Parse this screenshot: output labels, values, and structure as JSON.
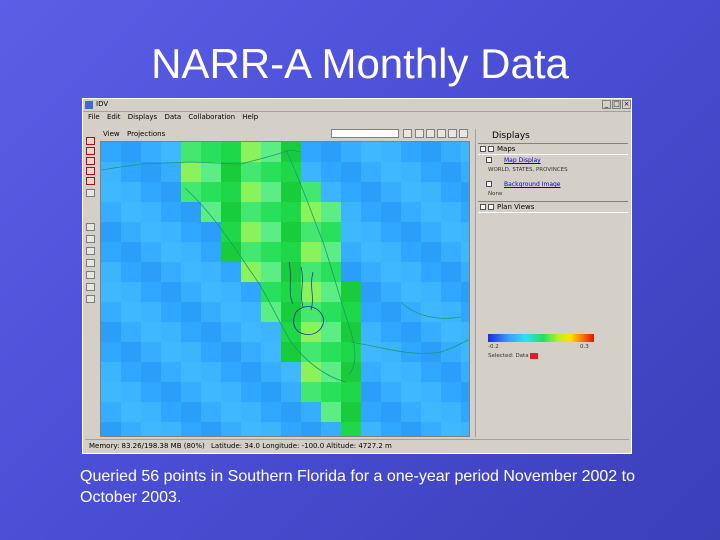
{
  "slide": {
    "title": "NARR-A Monthly Data",
    "caption": "Queried 56 points in Southern Florida for a one-year period November 2002 to October 2003."
  },
  "window": {
    "title": "IDV",
    "menu": [
      "File",
      "Edit",
      "Displays",
      "Data",
      "Collaboration",
      "Help"
    ],
    "view_menu": [
      "View",
      "Projections"
    ],
    "controls": [
      "_",
      "□",
      "×"
    ]
  },
  "status": {
    "memory": "Memory: 83.26/198.38 MB (80%)",
    "location": "Latitude: 34.0 Longitude: -100.0 Altitude: 4727.2 m"
  },
  "displays_panel": {
    "title": "Displays",
    "sections": [
      {
        "name": "Maps",
        "items": [
          {
            "label": "Map Display",
            "sub": "WORLD, STATES, PROVINCES"
          },
          {
            "label": "Background Image",
            "sub": "None"
          }
        ]
      },
      {
        "name": "Plan Views",
        "items": []
      }
    ],
    "colorbar": {
      "min": "-0.2",
      "max": "0.3"
    },
    "legend_label": "Selected: Data",
    "swatch_color": "#e02020"
  },
  "colors": {
    "slide_bg": "#4a4fd6",
    "window_bg": "#d4d0c8",
    "ocean": "#33aaff",
    "land_green": "#22dd44"
  }
}
